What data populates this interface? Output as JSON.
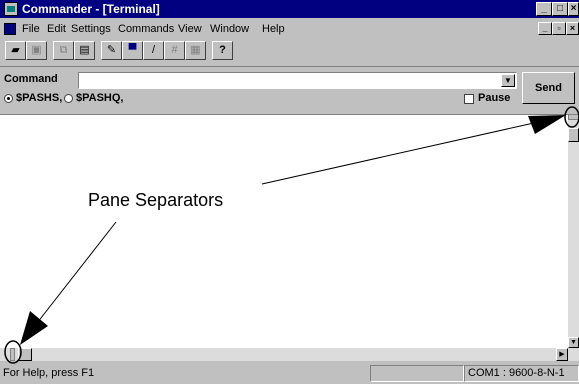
{
  "window": {
    "title": "Commander - [Terminal]",
    "controls": [
      "_",
      "□",
      "×"
    ],
    "mdi_controls": [
      "_",
      "▫",
      "×"
    ]
  },
  "menu": {
    "items": [
      "File",
      "Edit",
      "Settings",
      "Commands",
      "View",
      "Window",
      "Help"
    ]
  },
  "toolbar": {
    "icons": [
      "open-folder-icon",
      "save-icon",
      "copy-icon",
      "paste-icon",
      "script-icon",
      "terminal-icon",
      "pencil-icon",
      "grid-icon",
      "table-icon",
      "help-icon"
    ]
  },
  "command": {
    "label": "Command",
    "value": "",
    "send_label": "Send",
    "radio1": "$PASHS,",
    "radio2": "$PASHQ,",
    "pause_label": "Pause",
    "selected": "$PASHS,"
  },
  "annotation": {
    "label": "Pane Separators"
  },
  "status": {
    "help": "For Help, press F1",
    "com": "COM1 : 9600-8-N-1"
  },
  "colors": {
    "title_bg": "#000080",
    "chrome": "#c0c0c0"
  }
}
